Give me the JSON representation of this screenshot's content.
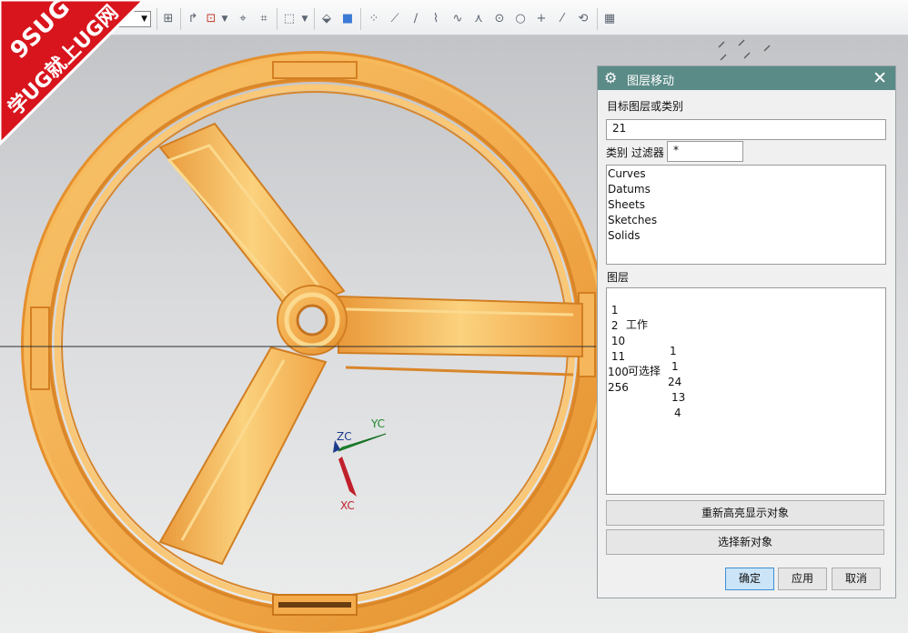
{
  "watermark": {
    "line1": "9SUG",
    "line2": "学UG就上UG网"
  },
  "axes_triad": {
    "zc": "ZC",
    "yc": "YC",
    "xc": "XC"
  },
  "toolbar": {
    "icons": [
      "point-icon",
      "arrow-icon",
      "filter-icon",
      "chevron-down-icon",
      "snap-icon",
      "snap-icon",
      "select-box-icon",
      "chevron-down-icon",
      "solid-icon",
      "cube-icon",
      "scatter-icon",
      "line-icon",
      "line-icon",
      "curve-icon",
      "spline-icon",
      "arc-icon",
      "circle-icon",
      "circle-icon",
      "plus-icon",
      "line-icon",
      "rotate-icon",
      "grid-icon"
    ]
  },
  "dialog": {
    "title": "图层移动",
    "target_label": "目标图层或类别",
    "target_value": "21",
    "filter_label": "类别 过滤器",
    "filter_value": "*",
    "categories": [
      "Curves",
      "Datums",
      "Sheets",
      "Sketches",
      "Solids"
    ],
    "layers_label": "图层",
    "layers": [
      {
        "num": " 1",
        "name": "工作",
        "count": ""
      },
      {
        "num": " 2",
        "name": "",
        "count": "1"
      },
      {
        "num": " 10",
        "name": "",
        "count": "1"
      },
      {
        "num": " 11",
        "name": "可选择",
        "count": "24"
      },
      {
        "num": "100",
        "name": "",
        "count": "13"
      },
      {
        "num": "256",
        "name": "",
        "count": "4"
      }
    ],
    "buttons": {
      "rehighlight": "重新高亮显示对象",
      "select_new": "选择新对象",
      "ok": "确定",
      "apply": "应用",
      "cancel": "取消"
    }
  },
  "colors": {
    "dialog_header": "#5a8b86",
    "model": "#f2a94a",
    "ok_button": "#cce4f7"
  }
}
